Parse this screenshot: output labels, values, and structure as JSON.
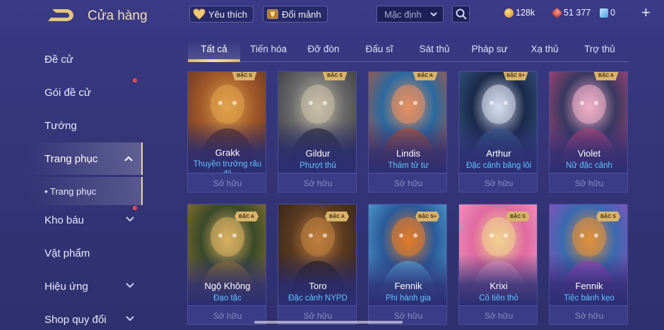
{
  "header": {
    "title": "Cửa hàng",
    "favorite_label": "Yêu thích",
    "exchange_label": "Đổi mảnh",
    "sort_value": "Mặc định",
    "currencies": [
      {
        "value": "128k",
        "icon": "gold-coin-icon",
        "color": "#e8b84a"
      },
      {
        "value": "51 377",
        "icon": "red-gem-icon",
        "color": "#e05b4a"
      },
      {
        "value": "0",
        "icon": "voucher-icon",
        "color": "#7ad0ff"
      }
    ]
  },
  "sidebar": {
    "items": [
      {
        "label": "Đề cử"
      },
      {
        "label": "Gói đề cử"
      },
      {
        "label": "Tướng"
      },
      {
        "label": "Trang phục"
      },
      {
        "label": "• Trang phục"
      },
      {
        "label": "Kho báu"
      },
      {
        "label": "Vật phẩm"
      },
      {
        "label": "Hiệu ứng"
      },
      {
        "label": "Shop quy đổi"
      }
    ]
  },
  "tabs": [
    "Tất cả",
    "Tiến hóa",
    "Đỡ đòn",
    "Đấu sĩ",
    "Sát thủ",
    "Pháp sư",
    "Xạ thủ",
    "Trợ thủ"
  ],
  "cards": [
    {
      "hero": "Grakk",
      "skin": "Thuyền trưởng râu đỏ",
      "status": "Sở hữu",
      "tier": "BẬC S",
      "colors": [
        "#a35a2a",
        "#5a2f1f",
        "#e0a24a"
      ]
    },
    {
      "hero": "Gildur",
      "skin": "Phượt thủ",
      "status": "Sở hữu",
      "tier": "BẬC S",
      "colors": [
        "#6a6a6a",
        "#2f2f35",
        "#c9c0a8"
      ]
    },
    {
      "hero": "Lindis",
      "skin": "Thám tử tư",
      "status": "Sở hữu",
      "tier": "BẬC A",
      "colors": [
        "#2b6aa0",
        "#c4532e",
        "#e89060"
      ]
    },
    {
      "hero": "Arthur",
      "skin": "Đặc cảnh băng lôi",
      "status": "Sở hữu",
      "tier": "BẬC S+",
      "colors": [
        "#1b2a4a",
        "#3b5f8f",
        "#d6dcef"
      ]
    },
    {
      "hero": "Violet",
      "skin": "Nữ đặc cảnh",
      "status": "Sở hữu",
      "tier": "BẬC A",
      "colors": [
        "#3a3860",
        "#c24a7a",
        "#f0b0c8"
      ]
    },
    {
      "hero": "Ngộ Không",
      "skin": "Đạo tặc",
      "status": "Sở hữu",
      "tier": "BẬC A",
      "colors": [
        "#3a4a2a",
        "#9a7a2a",
        "#d9b060"
      ]
    },
    {
      "hero": "Toro",
      "skin": "Đặc cảnh NYPD",
      "status": "Sở hữu",
      "tier": "BẬC A",
      "colors": [
        "#5a3a20",
        "#2a1e14",
        "#c08040"
      ]
    },
    {
      "hero": "Fennik",
      "skin": "Phi hành gia",
      "status": "Sở hữu",
      "tier": "BẬC S+",
      "colors": [
        "#2a5a9a",
        "#5ab0e0",
        "#e07a2a"
      ]
    },
    {
      "hero": "Krixi",
      "skin": "Cô tiên thỏ",
      "status": "Sở hữu",
      "tier": "BẬC S",
      "colors": [
        "#e06aa0",
        "#f5a0c8",
        "#f0d090"
      ]
    },
    {
      "hero": "Fennik",
      "skin": "Tiệc bánh kẹo",
      "status": "Sở hữu",
      "tier": "BẬC S",
      "colors": [
        "#3a6ab0",
        "#a04ac0",
        "#e0903a"
      ]
    }
  ]
}
